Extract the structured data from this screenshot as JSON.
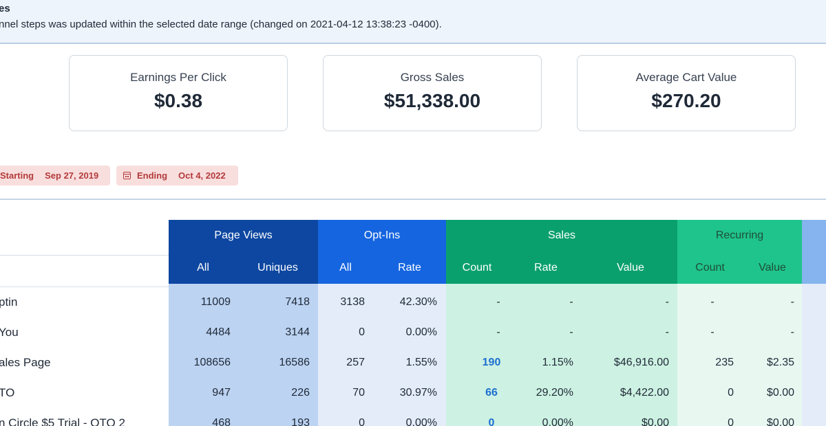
{
  "notice": {
    "title": "es",
    "text": "nnel steps was updated within the selected date range (changed on 2021-04-12 13:38:23 -0400)."
  },
  "stats": [
    {
      "label": "Earnings Per Click",
      "value": "$0.38"
    },
    {
      "label": "Gross Sales",
      "value": "$51,338.00"
    },
    {
      "label": "Average Cart Value",
      "value": "$270.20"
    }
  ],
  "date_range": {
    "start_label": "Starting",
    "start_value": "Sep 27, 2019",
    "end_label": "Ending",
    "end_value": "Oct 4, 2022",
    "icon": "calendar-icon"
  },
  "table": {
    "groups": {
      "page_views": "Page Views",
      "opt_ins": "Opt-Ins",
      "sales": "Sales",
      "recurring": "Recurring"
    },
    "sub_headers": {
      "pv_all": "All",
      "pv_uniques": "Uniques",
      "oi_all": "All",
      "oi_rate": "Rate",
      "s_count": "Count",
      "s_rate": "Rate",
      "s_value": "Value",
      "r_count": "Count",
      "r_value": "Value"
    },
    "rows": [
      {
        "name": "ptin",
        "pv_all": "11009",
        "pv_uniques": "7418",
        "oi_all": "3138",
        "oi_rate": "42.30%",
        "s_count": "-",
        "s_rate": "-",
        "s_value": "-",
        "r_count": "-",
        "r_value": "-"
      },
      {
        "name": " You",
        "pv_all": "4484",
        "pv_uniques": "3144",
        "oi_all": "0",
        "oi_rate": "0.00%",
        "s_count": "-",
        "s_rate": "-",
        "s_value": "-",
        "r_count": "-",
        "r_value": "-"
      },
      {
        "name": "ales Page",
        "pv_all": "108656",
        "pv_uniques": "16586",
        "oi_all": "257",
        "oi_rate": "1.55%",
        "s_count": "190",
        "s_rate": "1.15%",
        "s_value": "$46,916.00",
        "r_count": "235",
        "r_value": "$2.35"
      },
      {
        "name": "TO",
        "pv_all": "947",
        "pv_uniques": "226",
        "oi_all": "70",
        "oi_rate": "30.97%",
        "s_count": "66",
        "s_rate": "29.20%",
        "s_value": "$4,422.00",
        "r_count": "0",
        "r_value": "$0.00"
      },
      {
        "name": "n Circle $5 Trial - OTO 2",
        "pv_all": "468",
        "pv_uniques": "193",
        "oi_all": "0",
        "oi_rate": "0.00%",
        "s_count": "0",
        "s_rate": "0.00%",
        "s_value": "$0.00",
        "r_count": "0",
        "r_value": "$0.00"
      }
    ]
  },
  "colors": {
    "page_views_header": "#0d47a1",
    "opt_ins_header": "#1565e0",
    "sales_header": "#0aa06e",
    "recurring_header": "#1fc48c",
    "page_views_body": "#bcd3f2",
    "opt_ins_body": "#e3ecf8",
    "sales_body": "#cdf1e2",
    "recurring_body": "#e8f8f1"
  }
}
